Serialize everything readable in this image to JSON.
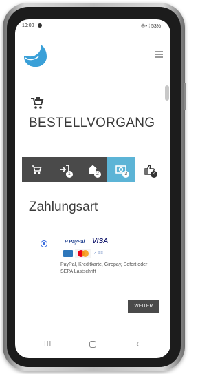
{
  "status_bar": {
    "time": "19:00",
    "right_text": "✇⁍ ⦙ 53%"
  },
  "header": {
    "logo_icon": "water-drop-logo-icon",
    "menu_icon": "hamburger-menu-icon"
  },
  "page": {
    "title_icon": "cart-icon",
    "title": "BESTELLVORGANG"
  },
  "steps": [
    {
      "icon": "cart-icon",
      "number": ""
    },
    {
      "icon": "login-icon",
      "number": "1"
    },
    {
      "icon": "home-icon",
      "number": "2"
    },
    {
      "icon": "money-icon",
      "number": "3"
    },
    {
      "icon": "thumbs-up-icon",
      "number": "4"
    }
  ],
  "payment": {
    "section_title": "Zahlungsart",
    "paypal_label": "P PayPal",
    "visa_label": "VISA",
    "giropay_label": "✓ ≡≡",
    "description": "PayPal, Kreditkarte, Giropay, Sofort oder SEPA Lastschrift",
    "next_button": "WEITER"
  },
  "navbar": {
    "recent": "III",
    "back": "‹"
  },
  "colors": {
    "step_dark": "#4a4a4a",
    "step_active": "#5cb4d6",
    "logo_blue": "#3aa0d8",
    "radio_blue": "#3b6ee0"
  }
}
